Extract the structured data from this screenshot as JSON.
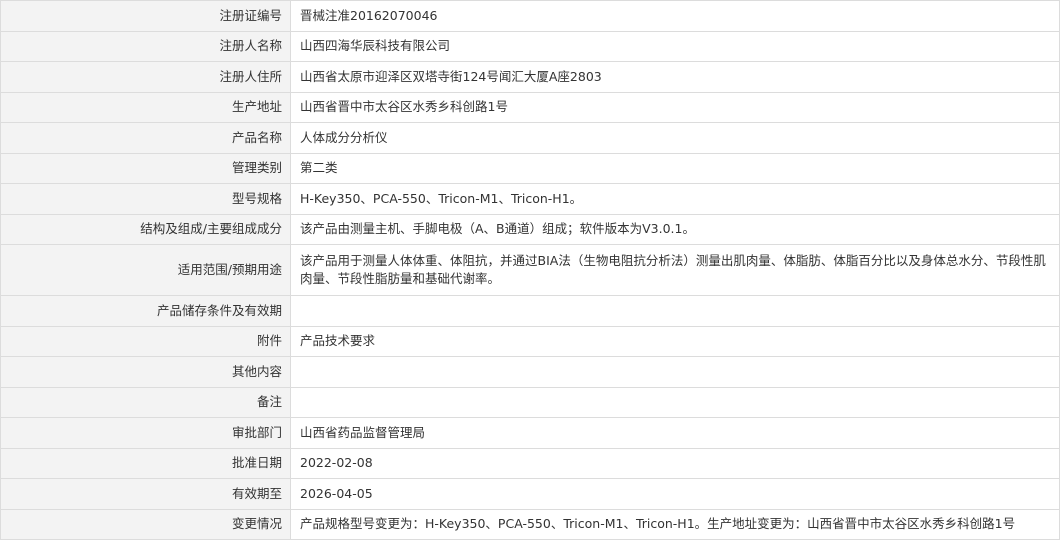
{
  "rows": [
    {
      "label": "注册证编号",
      "value": "晋械注准20162070046"
    },
    {
      "label": "注册人名称",
      "value": "山西四海华辰科技有限公司"
    },
    {
      "label": "注册人住所",
      "value": "山西省太原市迎泽区双塔寺街124号闻汇大厦A座2803"
    },
    {
      "label": "生产地址",
      "value": "山西省晋中市太谷区水秀乡科创路1号"
    },
    {
      "label": "产品名称",
      "value": "人体成分分析仪"
    },
    {
      "label": "管理类别",
      "value": "第二类"
    },
    {
      "label": "型号规格",
      "value": "H-Key350、PCA-550、Tricon-M1、Tricon-H1。"
    },
    {
      "label": "结构及组成/主要组成成分",
      "value": "该产品由测量主机、手脚电极（A、B通道）组成；软件版本为V3.0.1。"
    },
    {
      "label": "适用范围/预期用途",
      "value": "该产品用于测量人体体重、体阻抗，并通过BIA法（生物电阻抗分析法）测量出肌肉量、体脂肪、体脂百分比以及身体总水分、节段性肌肉量、节段性脂肪量和基础代谢率。"
    },
    {
      "label": "产品储存条件及有效期",
      "value": ""
    },
    {
      "label": "附件",
      "value": "产品技术要求"
    },
    {
      "label": "其他内容",
      "value": ""
    },
    {
      "label": "备注",
      "value": ""
    },
    {
      "label": "审批部门",
      "value": "山西省药品监督管理局"
    },
    {
      "label": "批准日期",
      "value": "2022-02-08"
    },
    {
      "label": "有效期至",
      "value": "2026-04-05"
    },
    {
      "label": "变更情况",
      "value": "产品规格型号变更为：H-Key350、PCA-550、Tricon-M1、Tricon-H1。生产地址变更为：山西省晋中市太谷区水秀乡科创路1号"
    }
  ]
}
